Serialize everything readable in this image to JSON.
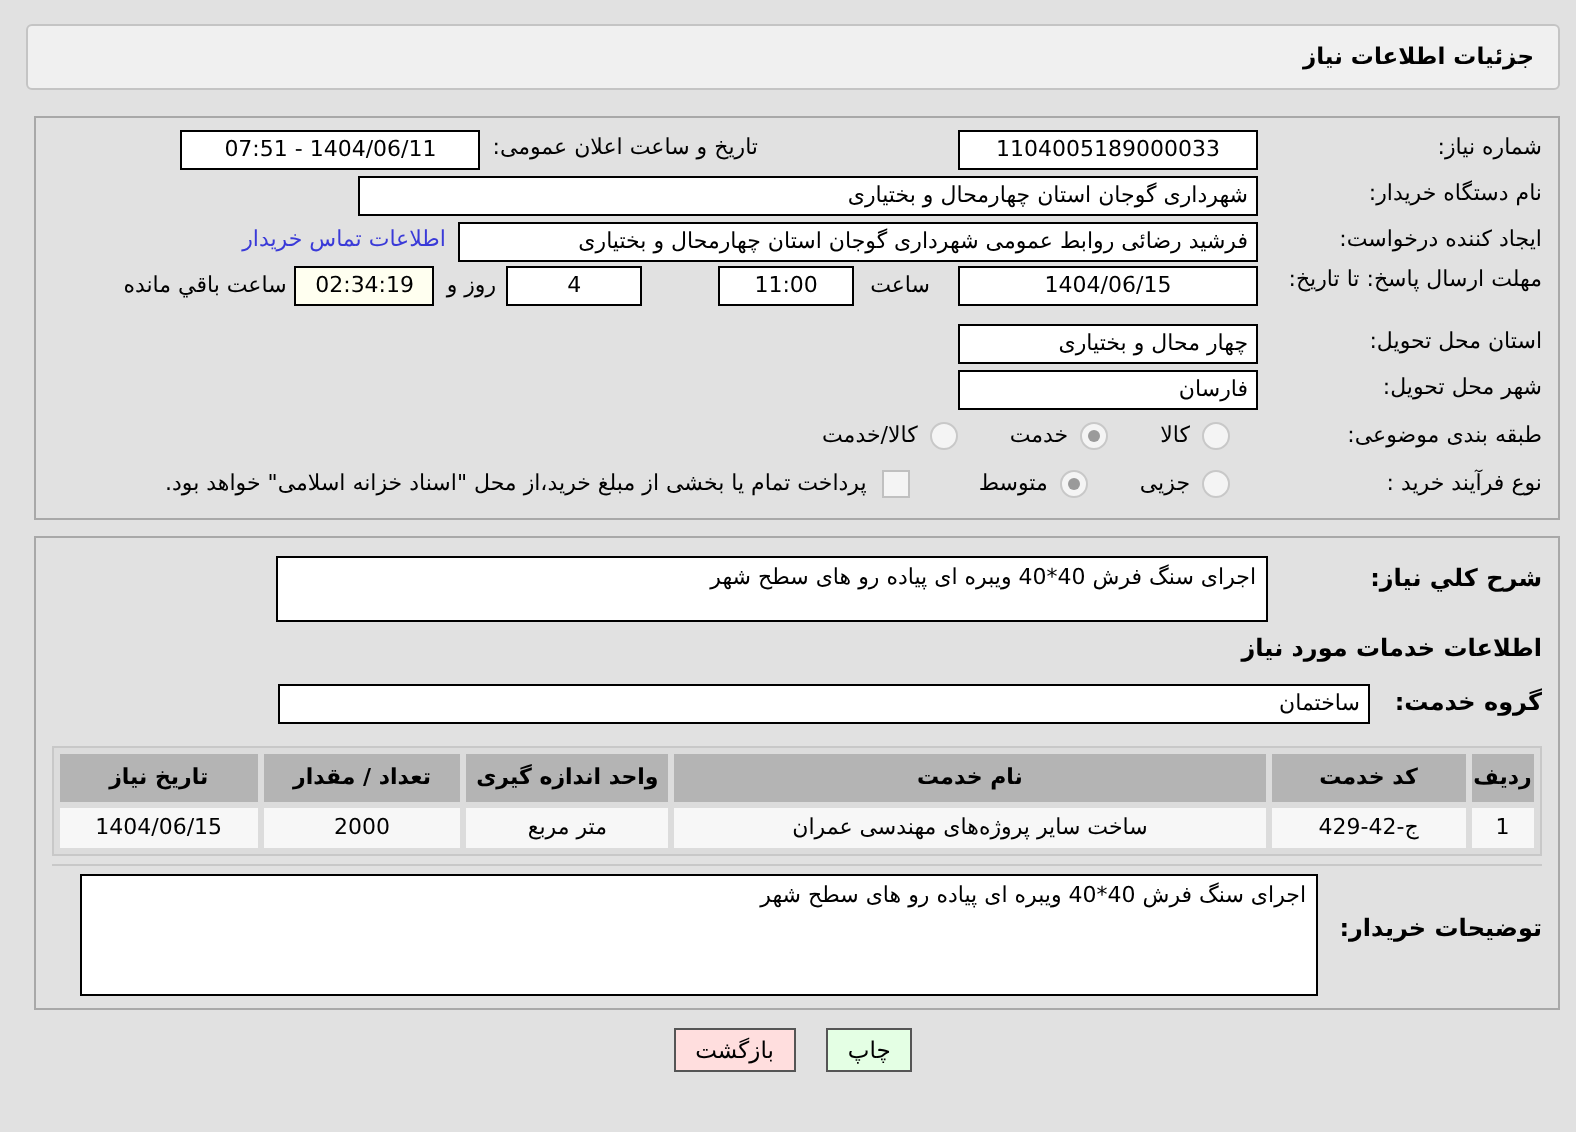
{
  "header": {
    "title": "جزئیات اطلاعات نیاز"
  },
  "need_number": {
    "label": "شماره نیاز:",
    "value": "1104005189000033"
  },
  "announce": {
    "label": "تاریخ و ساعت اعلان عمومی:",
    "value": "1404/06/11 - 07:51"
  },
  "buyer_org": {
    "label": "نام دستگاه خریدار:",
    "value": "شهرداری گوجان استان چهارمحال و بختیاری"
  },
  "requester": {
    "label": "ایجاد کننده درخواست:",
    "value": "فرشید رضائی روابط عمومی شهرداری گوجان استان چهارمحال و بختیاری",
    "link": "اطلاعات تماس خریدار"
  },
  "deadline": {
    "label": "مهلت ارسال پاسخ: تا تاریخ:",
    "date": "1404/06/15",
    "time_label": "ساعت",
    "time": "11:00",
    "days": "4",
    "days_label": "روز و",
    "remaining": "02:34:19",
    "remaining_label": "ساعت باقي مانده"
  },
  "province": {
    "label": "استان محل تحویل:",
    "value": "چهار محال و بختیاری"
  },
  "city": {
    "label": "شهر محل تحویل:",
    "value": "فارسان"
  },
  "category": {
    "label": "طبقه بندی موضوعی:",
    "options": [
      {
        "label": "کالا",
        "selected": false
      },
      {
        "label": "خدمت",
        "selected": true
      },
      {
        "label": "کالا/خدمت",
        "selected": false
      }
    ]
  },
  "process": {
    "label": "نوع فرآیند خرید :",
    "options": [
      {
        "label": "جزیی",
        "selected": false
      },
      {
        "label": "متوسط",
        "selected": true
      }
    ],
    "payment": {
      "checked": false,
      "text": "پرداخت تمام یا بخشی از مبلغ خرید،از محل \"اسناد خزانه اسلامی\" خواهد بود."
    }
  },
  "description": {
    "label": "شرح کلي نیاز:",
    "value": "اجرای سنگ فرش 40*40 ویبره ای پیاده رو های سطح شهر"
  },
  "services_title": "اطلاعات خدمات مورد نیاز",
  "service_group": {
    "label": "گروه خدمت:",
    "value": "ساختمان"
  },
  "table": {
    "columns": [
      "ردیف",
      "کد خدمت",
      "نام خدمت",
      "واحد اندازه گیری",
      "تعداد / مقدار",
      "تاریخ نیاز"
    ],
    "rows": [
      [
        "1",
        "ج-42-429",
        "ساخت سایر پروژه‌های مهندسی عمران",
        "متر مربع",
        "2000",
        "1404/06/15"
      ]
    ]
  },
  "buyer_notes": {
    "label": "توضیحات خریدار:",
    "value": "اجرای سنگ فرش 40*40 ویبره ای پیاده رو های سطح شهر"
  },
  "buttons": [
    {
      "label": "چاپ",
      "kind": "print"
    },
    {
      "label": "بازگشت",
      "kind": "back"
    }
  ]
}
